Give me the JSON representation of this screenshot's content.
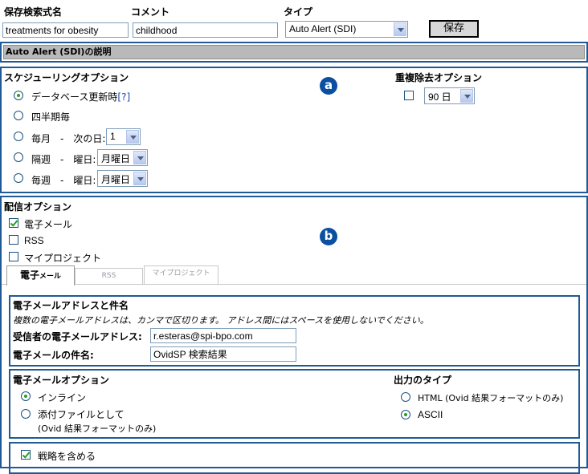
{
  "header": {
    "saved_search_label": "保存検索式名",
    "comment_label": "コメント",
    "type_label": "タイプ",
    "saved_search_value": "treatments for obesity",
    "comment_value": "childhood",
    "type_value": "Auto Alert (SDI)",
    "save_button": "保存"
  },
  "description_bar": "Auto Alert (SDI)の説明",
  "markers": {
    "a": "a",
    "b": "b"
  },
  "schedule": {
    "title": "スケジューリングオプション",
    "db_update": "データベース更新時",
    "help": "[?]",
    "quarterly": "四半期毎",
    "monthly": "毎月　-　次の日:",
    "monthly_value": "1",
    "biweekly": "隔週　-　曜日:",
    "biweekly_value": "月曜日",
    "weekly": "毎週　-　曜日:",
    "weekly_value": "月曜日"
  },
  "dedup": {
    "title": "重複除去オプション",
    "value": "90 日"
  },
  "delivery": {
    "title": "配信オプション",
    "email": "電子メール",
    "rss": "RSS",
    "my_project": "マイプロジェクト"
  },
  "tabs": {
    "email": "電子",
    "email_small": "メール",
    "rss": "RSS",
    "my_project": "マイプロジェクト"
  },
  "address": {
    "title": "電子メールアドレスと件名",
    "note": "複数の電子メールアドレスは、カンマで区切ります。 アドレス間にはスペースを使用しないでください。",
    "recipient_label": "受信者の電子メールアドレス:",
    "recipient_value": "r.esteras@spi-bpo.com",
    "subject_label": "電子メールの件名:",
    "subject_value": "OvidSP 検索結果"
  },
  "email_options": {
    "title": "電子メールオプション",
    "inline": "インライン",
    "attach_line1": "添付ファイルとして",
    "attach_line2": "(Ovid 結果フォーマットのみ)"
  },
  "output_type": {
    "title": "出力のタイプ",
    "html": "HTML (Ovid 結果フォーマットのみ)",
    "ascii": "ASCII"
  },
  "strategy": {
    "label": "戦略を含める"
  }
}
